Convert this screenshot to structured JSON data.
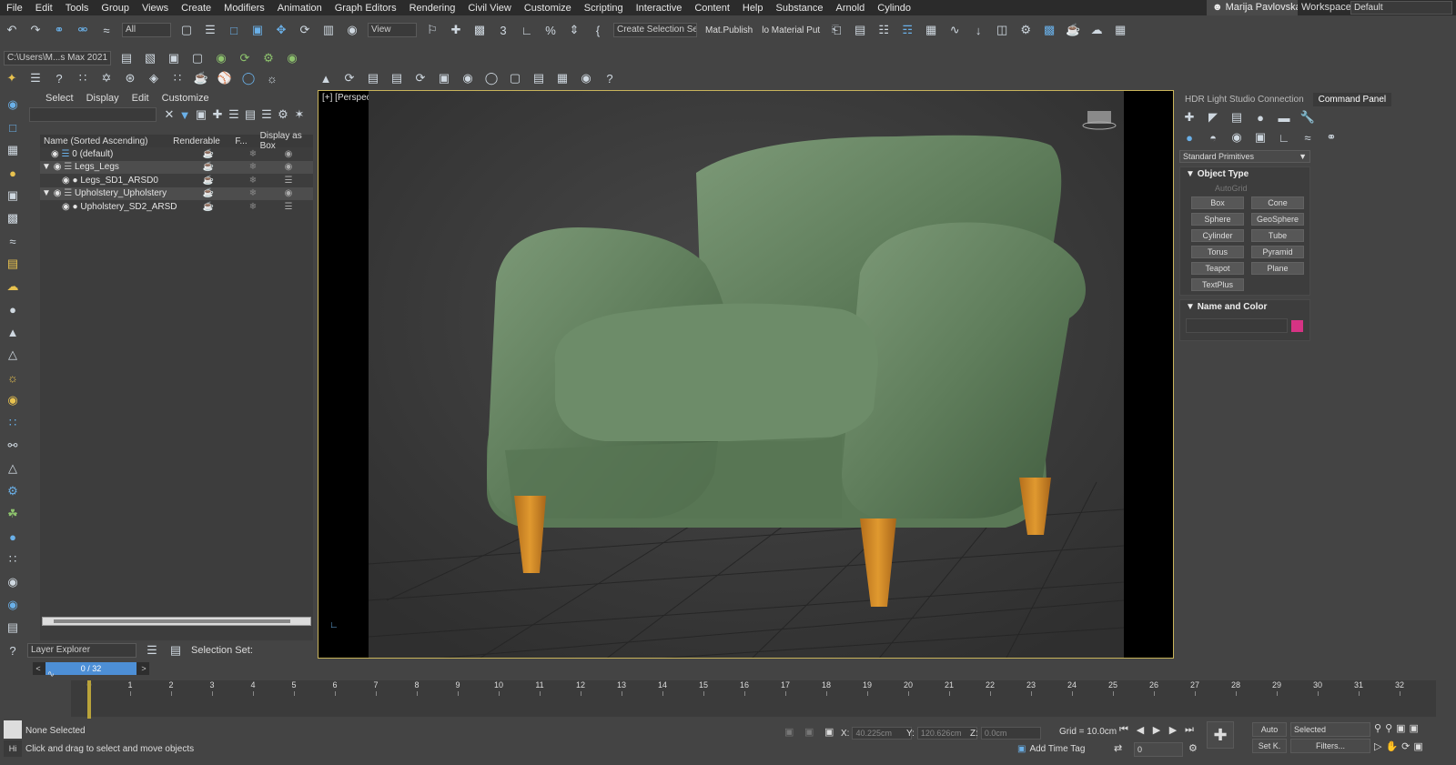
{
  "menu": [
    "File",
    "Edit",
    "Tools",
    "Group",
    "Views",
    "Create",
    "Modifiers",
    "Animation",
    "Graph Editors",
    "Rendering",
    "Civil View",
    "Customize",
    "Scripting",
    "Interactive",
    "Content",
    "Help",
    "Substance",
    "Arnold",
    "Cylindo"
  ],
  "user": "Marija Pavlovska",
  "workspaces_label": "Workspaces:",
  "workspace": "Default",
  "toolbar": {
    "filter_select": "All",
    "view_select": "View",
    "selection_set": "Create Selection Set",
    "mat_publish": "Mat.Publish",
    "material_put": "lo Material Put",
    "path": "C:\\Users\\M...s Max 2021"
  },
  "scene_explorer": {
    "menu": [
      "Select",
      "Display",
      "Edit",
      "Customize"
    ],
    "columns": [
      "Name (Sorted Ascending)",
      "Renderable",
      "F...",
      "Display as Box"
    ],
    "rows": [
      {
        "name": "0 (default)"
      },
      {
        "name": "Legs_Legs"
      },
      {
        "name": "Legs_SD1_ARSD0"
      },
      {
        "name": "Upholstery_Upholstery"
      },
      {
        "name": "Upholstery_SD2_ARSD1"
      }
    ],
    "footer_select": "Layer Explorer",
    "selection_set_label": "Selection Set:"
  },
  "viewport": {
    "label": "[+] [Perspective ] [Standard ] [Default Shading ]",
    "colors": {
      "chair": "#5b7a58",
      "legs": "#d08a2a",
      "border": "#c9b45b"
    }
  },
  "command_panel": {
    "tabs": [
      "HDR Light Studio Connection",
      "Command Panel"
    ],
    "dropdown": "Standard Primitives",
    "object_type_title": "Object Type",
    "autogrid": "AutoGrid",
    "primitives": [
      "Box",
      "Cone",
      "Sphere",
      "GeoSphere",
      "Cylinder",
      "Tube",
      "Torus",
      "Pyramid",
      "Teapot",
      "Plane",
      "TextPlus"
    ],
    "name_color_title": "Name and Color",
    "object_color": "#d63384"
  },
  "timeline": {
    "slider_text": "0 / 32",
    "ticks": [
      "0",
      "1",
      "2",
      "3",
      "4",
      "5",
      "6",
      "7",
      "8",
      "9",
      "10",
      "11",
      "12",
      "13",
      "14",
      "15",
      "16",
      "17",
      "18",
      "19",
      "20",
      "21",
      "22",
      "23",
      "24",
      "25",
      "26",
      "27",
      "28",
      "29",
      "30",
      "31",
      "32"
    ]
  },
  "status": {
    "selection": "None Selected",
    "prompt": "Click and drag to select and move objects",
    "x_label": "X:",
    "x_value": "40.225cm",
    "y_label": "Y:",
    "y_value": "120.626cm",
    "z_label": "Z:",
    "z_value": "0.0cm",
    "grid": "Grid = 10.0cm",
    "add_time_tag": "Add Time Tag",
    "auto": "Auto",
    "selected": "Selected",
    "setk": "Set K.",
    "filters": "Filters...",
    "frame": "0"
  }
}
